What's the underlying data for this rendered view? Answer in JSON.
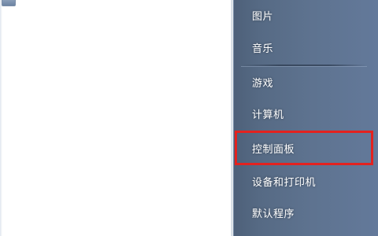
{
  "start_menu": {
    "right_pane": {
      "items": [
        {
          "label": "图片"
        },
        {
          "label": "音乐"
        },
        {
          "label": "游戏"
        },
        {
          "label": "计算机"
        },
        {
          "label": "控制面板",
          "highlighted": true
        },
        {
          "label": "设备和打印机"
        },
        {
          "label": "默认程序"
        }
      ]
    },
    "highlight_color": "#e3221f",
    "pane_color": "#5a6f8c"
  }
}
